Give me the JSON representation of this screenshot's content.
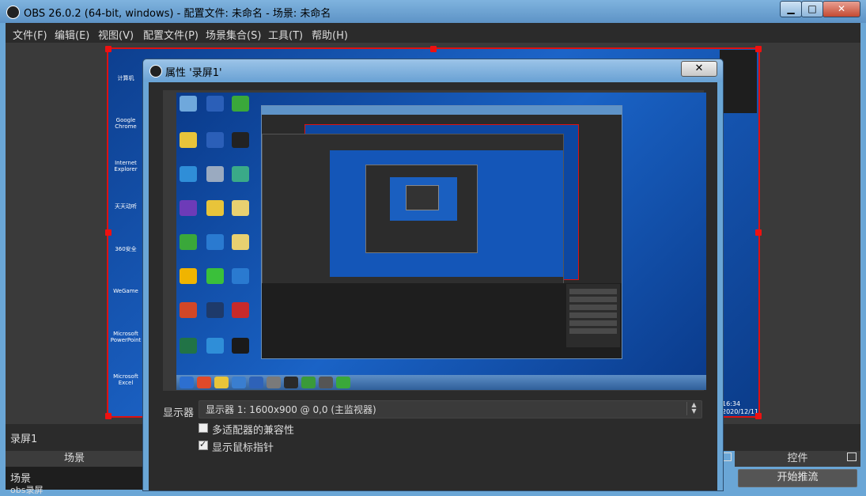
{
  "app": {
    "title": "OBS 26.0.2 (64-bit, windows) - 配置文件: 未命名 - 场景: 未命名",
    "window_controls": {
      "minimize": "▁",
      "maximize": "□",
      "close": "✕"
    }
  },
  "menu": [
    "文件(F)",
    "编辑(E)",
    "视图(V)",
    "配置文件(P)",
    "场景集合(S)",
    "工具(T)",
    "帮助(H)"
  ],
  "captured_desktop": {
    "icons": [
      {
        "label": "计算机",
        "color": "#6fa8dc"
      },
      {
        "label": "Google Chrome",
        "color": "#e8c43a"
      },
      {
        "label": "Internet Explorer",
        "color": "#2f8ed8"
      },
      {
        "label": "天天动听",
        "color": "#6d3bb8"
      },
      {
        "label": "360安全",
        "color": "#3aa83a"
      },
      {
        "label": "WeGame",
        "color": "#f0b400"
      },
      {
        "label": "Microsoft PowerPoint",
        "color": "#d24726"
      },
      {
        "label": "Microsoft Excel",
        "color": "#217346"
      }
    ],
    "clock": "16:34",
    "date": "2020/12/11"
  },
  "dialog": {
    "title": "属性 '录屏1'",
    "close": "✕",
    "display_label": "显示器",
    "display_value": "显示器 1: 1600x900 @ 0,0 (主监视器)",
    "spin_up": "▲",
    "spin_down": "▼",
    "compat_label": "多适配器的兼容性",
    "compat_checked": false,
    "cursor_label": "显示鼠标指针",
    "cursor_checked": true,
    "checkmark": "✓",
    "preview_taskbar_icons": [
      "#2d6fd0",
      "#e04a2a",
      "#e8c43a",
      "#3a7ed0",
      "#2e62b8",
      "#7a7a7a",
      "#2a2a2a",
      "#3a9a3a"
    ]
  },
  "source_label": "录屏1",
  "docks": {
    "scenes_title": "场景",
    "scenes_items": [
      "场景",
      "obs录屏"
    ],
    "controls_title": "控件",
    "start_stream": "开始推流"
  },
  "colors": {
    "selection_red": "#dd1111",
    "obs_dark": "#2b2b2b"
  }
}
